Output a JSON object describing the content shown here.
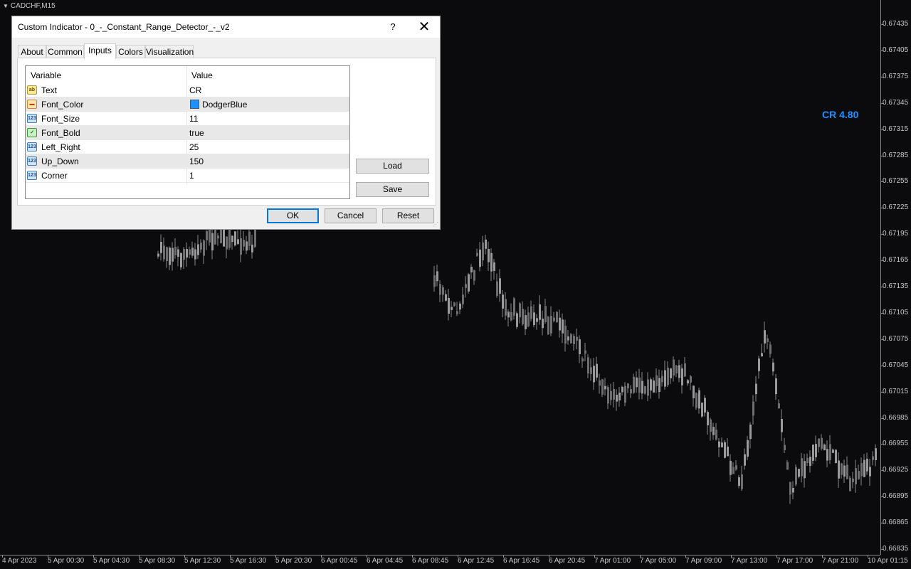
{
  "chart": {
    "symbol": "CADCHF,M15",
    "indicator_label": "CR 4.80",
    "indicator_color": "#1e90ff",
    "price_labels": [
      "0.67435",
      "0.67405",
      "0.67375",
      "0.67345",
      "0.67315",
      "0.67285",
      "0.67255",
      "0.67225",
      "0.67195",
      "0.67165",
      "0.67135",
      "0.67105",
      "0.67075",
      "0.67045",
      "0.67015",
      "0.66985",
      "0.66955",
      "0.66925",
      "0.66895",
      "0.66865",
      "0.66835"
    ],
    "time_labels": [
      "4 Apr 2023",
      "5 Apr 00:30",
      "5 Apr 04:30",
      "5 Apr 08:30",
      "5 Apr 12:30",
      "5 Apr 16:30",
      "5 Apr 20:30",
      "6 Apr 00:45",
      "6 Apr 04:45",
      "6 Apr 08:45",
      "6 Apr 12:45",
      "6 Apr 16:45",
      "6 Apr 20:45",
      "7 Apr 01:00",
      "7 Apr 05:00",
      "7 Apr 09:00",
      "7 Apr 13:00",
      "7 Apr 17:00",
      "7 Apr 21:00",
      "10 Apr 01:15"
    ]
  },
  "dialog": {
    "title": "Custom Indicator - 0_-_Constant_Range_Detector_-_v2",
    "help_label": "?",
    "close_label": "✕",
    "tabs": [
      {
        "label": "About",
        "active": false
      },
      {
        "label": "Common",
        "active": false
      },
      {
        "label": "Inputs",
        "active": true
      },
      {
        "label": "Colors",
        "active": false
      },
      {
        "label": "Visualization",
        "active": false
      }
    ],
    "grid": {
      "col_variable": "Variable",
      "col_value": "Value",
      "rows": [
        {
          "icon": "ab",
          "type": "text",
          "variable": "Text",
          "value": "CR"
        },
        {
          "icon": "color-icon",
          "type": "color",
          "variable": "Font_Color",
          "value": "DodgerBlue",
          "swatch": "#1e90ff"
        },
        {
          "icon": "123",
          "type": "number",
          "variable": "Font_Size",
          "value": "11"
        },
        {
          "icon": "bool-icon",
          "type": "bool",
          "variable": "Font_Bold",
          "value": "true"
        },
        {
          "icon": "123",
          "type": "number",
          "variable": "Left_Right",
          "value": "25"
        },
        {
          "icon": "123",
          "type": "number",
          "variable": "Up_Down",
          "value": "150"
        },
        {
          "icon": "123",
          "type": "number",
          "variable": "Corner",
          "value": "1"
        }
      ]
    },
    "buttons": {
      "load": "Load",
      "save": "Save",
      "ok": "OK",
      "cancel": "Cancel",
      "reset": "Reset"
    }
  }
}
